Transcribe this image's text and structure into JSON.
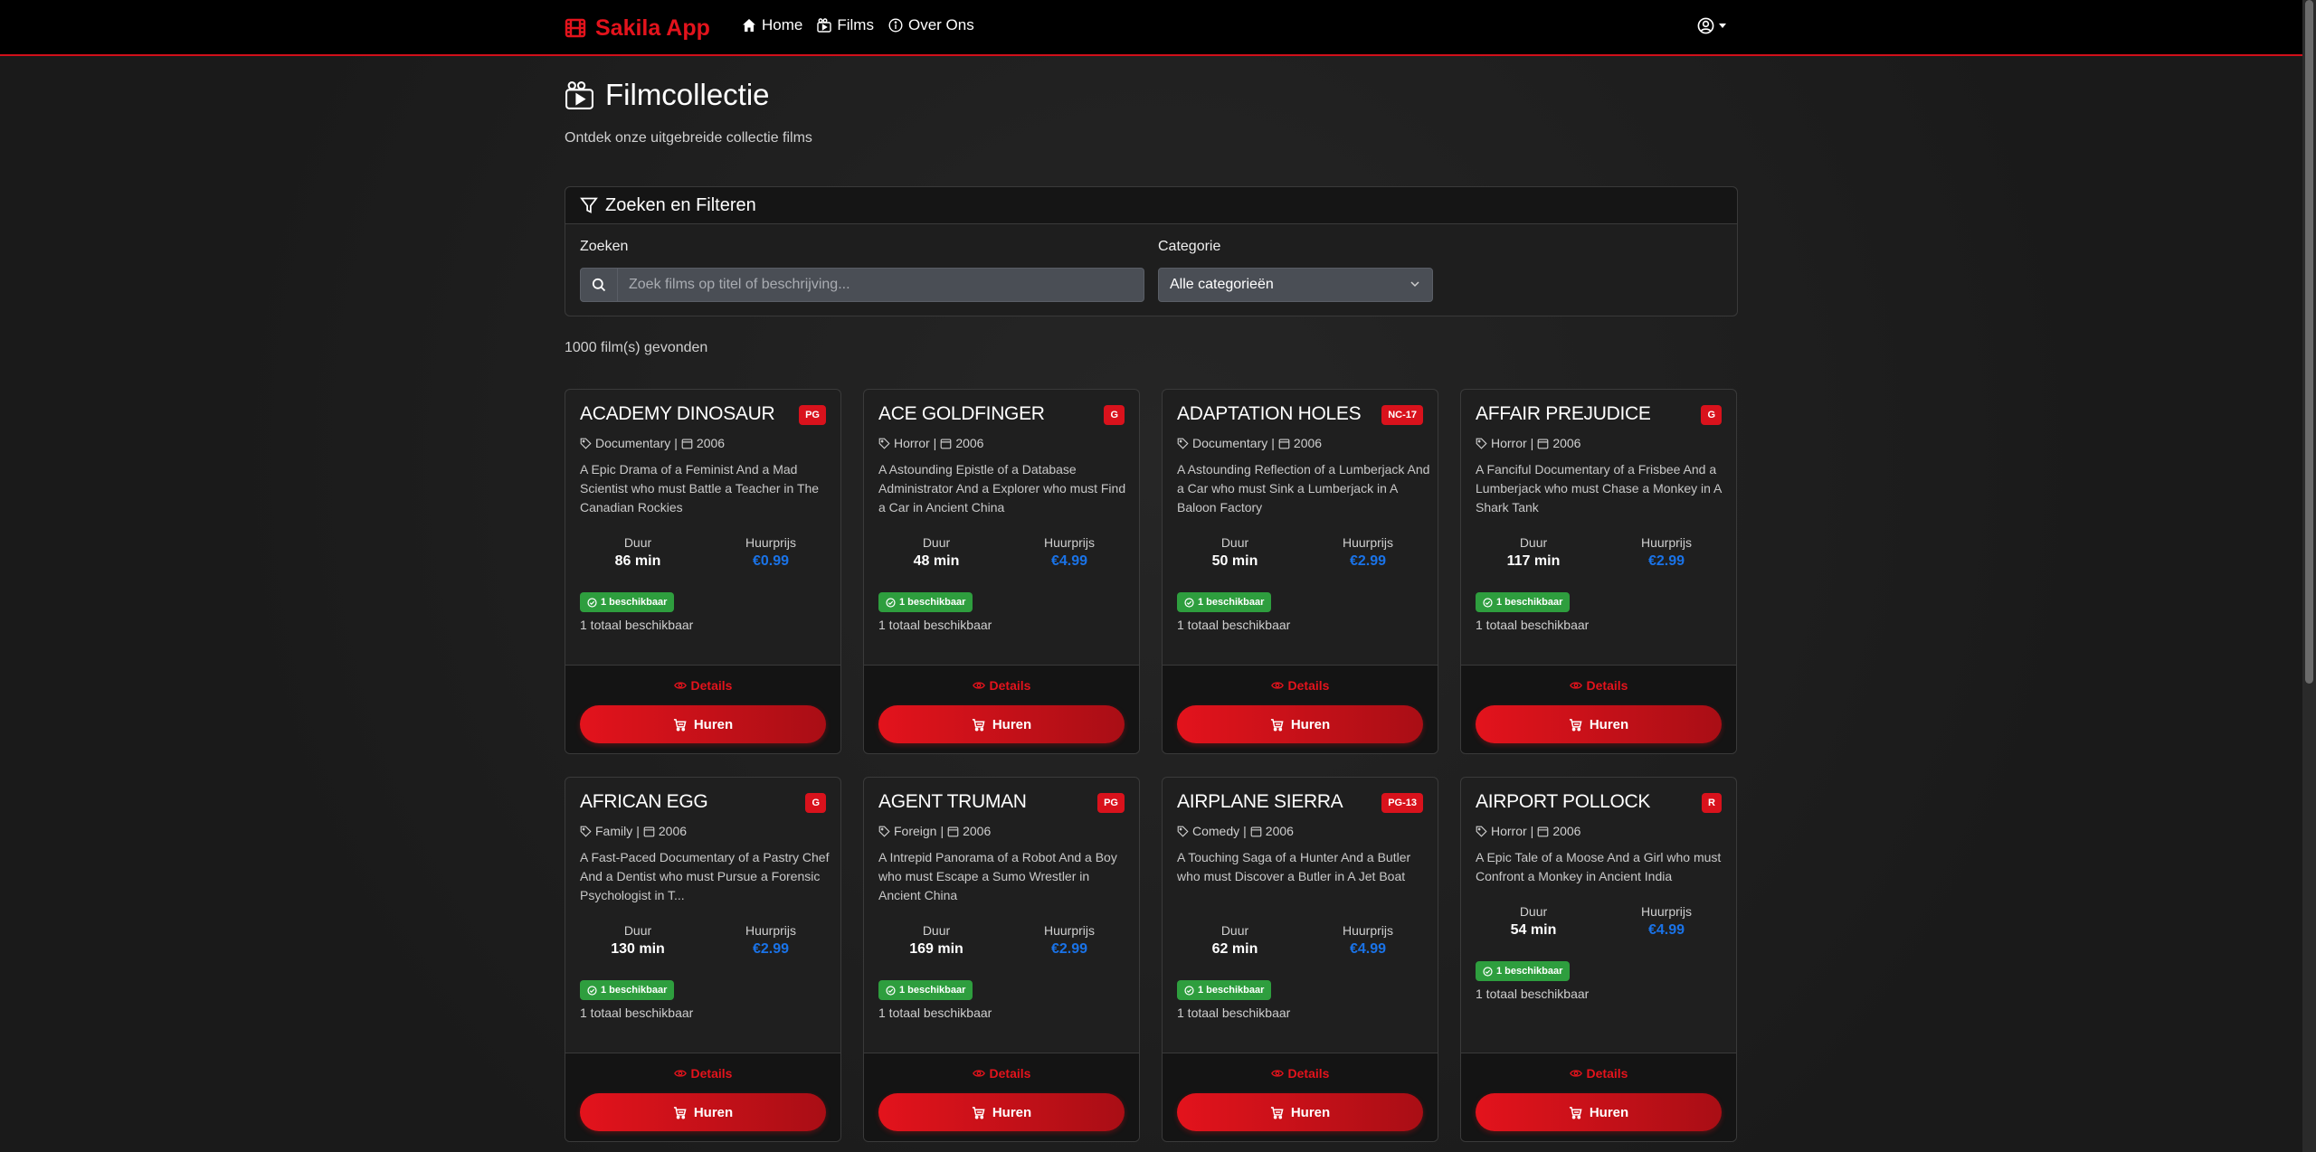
{
  "nav": {
    "brand": "Sakila App",
    "links": [
      {
        "label": "Home",
        "icon": "house-icon"
      },
      {
        "label": "Films",
        "icon": "film-icon"
      },
      {
        "label": "Over Ons",
        "icon": "info-icon"
      }
    ]
  },
  "header": {
    "title": "Filmcollectie",
    "subtitle": "Ontdek onze uitgebreide collectie films"
  },
  "filters": {
    "title": "Zoeken en Filteren",
    "search_label": "Zoeken",
    "search_placeholder": "Zoek films op titel of beschrijving...",
    "category_label": "Categorie",
    "category_selected": "Alle categorieën"
  },
  "results": {
    "count_text": "1000 film(s) gevonden"
  },
  "labels": {
    "duration": "Duur",
    "price": "Huurprijs",
    "details": "Details",
    "rent": "Huren"
  },
  "colors": {
    "accent": "#e3131c",
    "price": "#1a73e8",
    "available": "#2e9e3e"
  },
  "films": [
    {
      "title": "ACADEMY DINOSAUR",
      "rating": "PG",
      "category": "Documentary",
      "year": "2006",
      "description": "A Epic Drama of a Feminist And a Mad Scientist who must Battle a Teacher in The Canadian Rockies",
      "duration": "86 min",
      "price": "€0.99",
      "available": "1 beschikbaar",
      "total": "1 totaal beschikbaar"
    },
    {
      "title": "ACE GOLDFINGER",
      "rating": "G",
      "category": "Horror",
      "year": "2006",
      "description": "A Astounding Epistle of a Database Administrator And a Explorer who must Find a Car in Ancient China",
      "duration": "48 min",
      "price": "€4.99",
      "available": "1 beschikbaar",
      "total": "1 totaal beschikbaar"
    },
    {
      "title": "ADAPTATION HOLES",
      "rating": "NC-17",
      "category": "Documentary",
      "year": "2006",
      "description": "A Astounding Reflection of a Lumberjack And a Car who must Sink a Lumberjack in A Baloon Factory",
      "duration": "50 min",
      "price": "€2.99",
      "available": "1 beschikbaar",
      "total": "1 totaal beschikbaar"
    },
    {
      "title": "AFFAIR PREJUDICE",
      "rating": "G",
      "category": "Horror",
      "year": "2006",
      "description": "A Fanciful Documentary of a Frisbee And a Lumberjack who must Chase a Monkey in A Shark Tank",
      "duration": "117 min",
      "price": "€2.99",
      "available": "1 beschikbaar",
      "total": "1 totaal beschikbaar"
    },
    {
      "title": "AFRICAN EGG",
      "rating": "G",
      "category": "Family",
      "year": "2006",
      "description": "A Fast-Paced Documentary of a Pastry Chef And a Dentist who must Pursue a Forensic Psychologist in T...",
      "duration": "130 min",
      "price": "€2.99",
      "available": "1 beschikbaar",
      "total": "1 totaal beschikbaar"
    },
    {
      "title": "AGENT TRUMAN",
      "rating": "PG",
      "category": "Foreign",
      "year": "2006",
      "description": "A Intrepid Panorama of a Robot And a Boy who must Escape a Sumo Wrestler in Ancient China",
      "duration": "169 min",
      "price": "€2.99",
      "available": "1 beschikbaar",
      "total": "1 totaal beschikbaar"
    },
    {
      "title": "AIRPLANE SIERRA",
      "rating": "PG-13",
      "category": "Comedy",
      "year": "2006",
      "description": "A Touching Saga of a Hunter And a Butler who must Discover a Butler in A Jet Boat",
      "duration": "62 min",
      "price": "€4.99",
      "available": "1 beschikbaar",
      "total": "1 totaal beschikbaar"
    },
    {
      "title": "AIRPORT POLLOCK",
      "rating": "R",
      "category": "Horror",
      "year": "2006",
      "description": "A Epic Tale of a Moose And a Girl who must Confront a Monkey in Ancient India",
      "duration": "54 min",
      "price": "€4.99",
      "available": "1 beschikbaar",
      "total": "1 totaal beschikbaar"
    }
  ]
}
